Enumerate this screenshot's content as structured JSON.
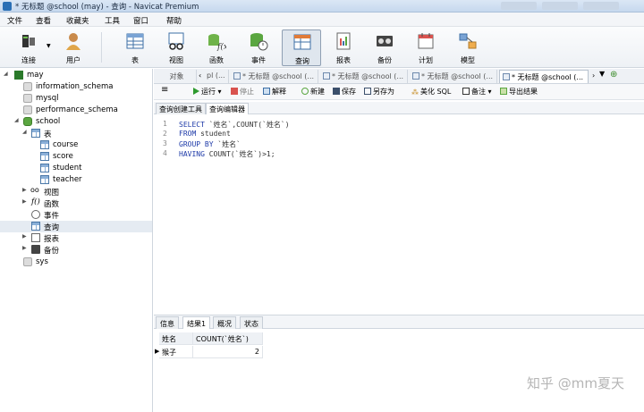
{
  "window": {
    "title": "* 无标题 @school (may) - 查询 - Navicat Premium"
  },
  "menu": [
    "文件",
    "查看",
    "收藏夹",
    "工具",
    "窗口",
    "帮助"
  ],
  "toolbar": [
    {
      "label": "连接",
      "icon": "connection-icon"
    },
    {
      "label": "用户",
      "icon": "user-icon"
    },
    {
      "label": "表",
      "icon": "table-icon"
    },
    {
      "label": "视图",
      "icon": "view-icon"
    },
    {
      "label": "函数",
      "icon": "function-icon"
    },
    {
      "label": "事件",
      "icon": "event-icon"
    },
    {
      "label": "查询",
      "icon": "query-icon",
      "active": true
    },
    {
      "label": "报表",
      "icon": "report-icon"
    },
    {
      "label": "备份",
      "icon": "backup-icon"
    },
    {
      "label": "计划",
      "icon": "schedule-icon"
    },
    {
      "label": "模型",
      "icon": "model-icon"
    }
  ],
  "tree": {
    "connection": "may",
    "databases": [
      "information_schema",
      "mysql",
      "performance_schema"
    ],
    "school": {
      "name": "school",
      "tables_label": "表",
      "tables": [
        "course",
        "score",
        "student",
        "teacher"
      ],
      "views_label": "视图",
      "functions_label": "函数",
      "events_label": "事件",
      "queries_label": "查询",
      "reports_label": "报表",
      "backups_label": "备份"
    },
    "sys": "sys"
  },
  "tabs": {
    "objects": "对象",
    "items": [
      "pl (...",
      "* 无标题 @school (...",
      "* 无标题 @school (...",
      "* 无标题 @school (...",
      "* 无标题 @school (..."
    ]
  },
  "query_toolbar": {
    "run": "运行",
    "stop": "停止",
    "explain": "解释",
    "new": "新建",
    "save": "保存",
    "save_as": "另存为",
    "beautify": "美化 SQL",
    "comment": "备注",
    "export": "导出结果"
  },
  "subtabs": [
    "查询创建工具",
    "查询编辑器"
  ],
  "editor": {
    "lines": [
      {
        "no": "1",
        "kw": "SELECT",
        "rest": " `姓名`,COUNT(`姓名`)"
      },
      {
        "no": "2",
        "kw": "FROM",
        "rest": " student"
      },
      {
        "no": "3",
        "kw": "GROUP BY",
        "rest": " `姓名`"
      },
      {
        "no": "4",
        "kw": "HAVING",
        "rest": " COUNT(`姓名`)>1;"
      }
    ]
  },
  "result_tabs": [
    "信息",
    "结果1",
    "概况",
    "状态"
  ],
  "result": {
    "columns": [
      "姓名",
      "COUNT(`姓名`)"
    ],
    "rows": [
      [
        "猴子",
        "2"
      ]
    ]
  },
  "watermark": "知乎 @mm夏天"
}
